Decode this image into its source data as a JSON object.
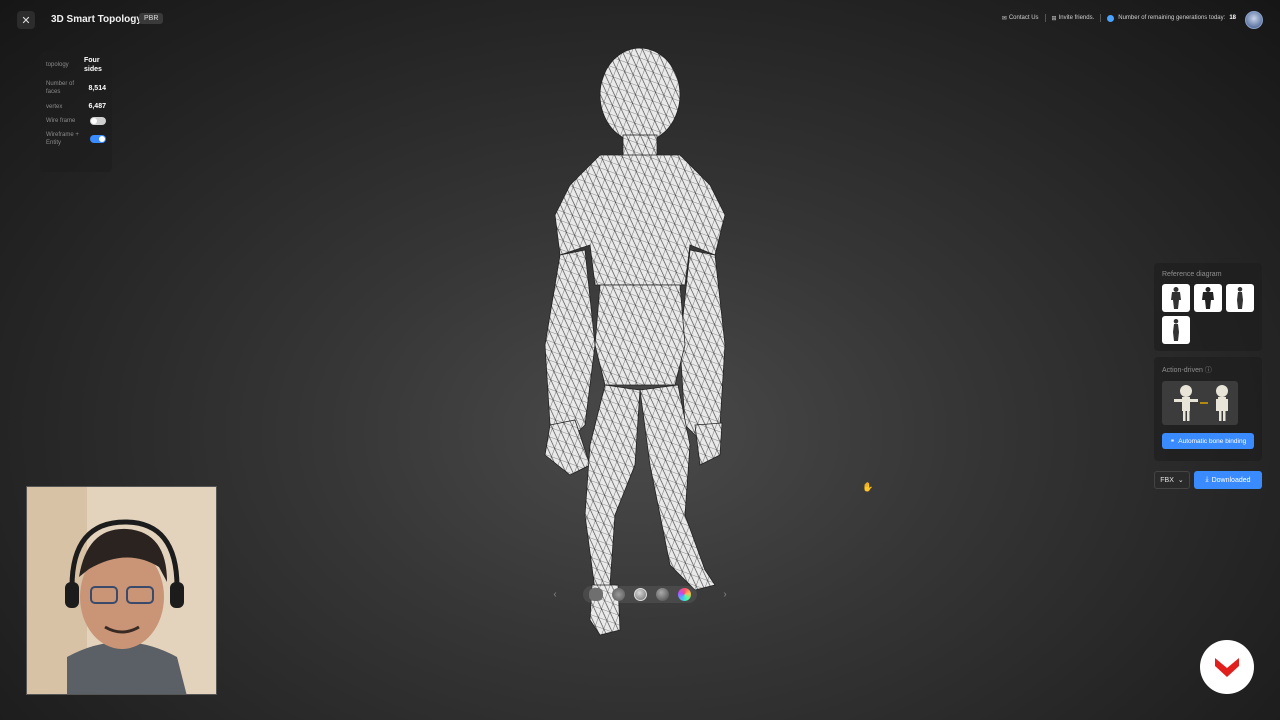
{
  "header": {
    "close_icon": "close-icon",
    "title": "3D Smart Topology",
    "badge": "PBR",
    "contact_label": "Contact Us",
    "invite_label": "Invite friends.",
    "generations_label": "Number of remaining generations today:",
    "generations_count": "18"
  },
  "info": {
    "topology_label": "topology",
    "topology_value": "Four sides",
    "faces_label": "Number of faces",
    "faces_value": "8,514",
    "vertex_label": "vertex",
    "vertex_value": "6,487",
    "wireframe_label": "Wire frame",
    "wireframe_on": false,
    "wireframe_entity_label": "Wireframe + Entity",
    "wireframe_entity_on": true
  },
  "side": {
    "reference_title": "Reference diagram",
    "action_title": "Action-driven",
    "bone_button": "Automatic bone binding",
    "format_value": "FBX",
    "download_label": "Downloaded"
  },
  "colors": {
    "accent": "#3a8bff",
    "logo_red": "#e1201e"
  }
}
